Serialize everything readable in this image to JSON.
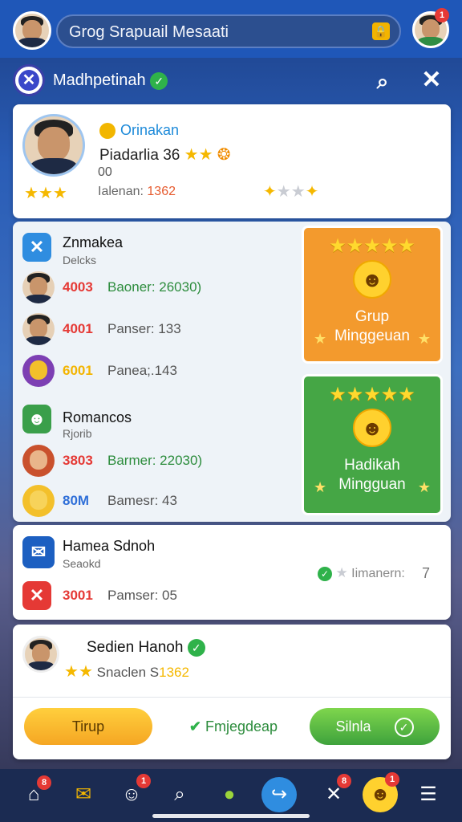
{
  "topbar": {
    "search_text": "Grog Srapuail Mesaati",
    "notification_badge": "1"
  },
  "header": {
    "title": "Madhpetinah"
  },
  "profile": {
    "role": "Orinakan",
    "name": "Piadarlia 36",
    "sub": "00",
    "rank_label": "Ialenan:",
    "rank_value": "1362"
  },
  "groups": [
    {
      "title": "Znmakea",
      "subtitle": "Delcks",
      "rows": [
        {
          "score": "4003",
          "name": "Baoner: 26030)"
        },
        {
          "score": "4001",
          "name": "Panser: 133"
        },
        {
          "score": "6001",
          "name": "Panea;.143"
        }
      ]
    },
    {
      "title": "Romancos",
      "subtitle": "Rjorib",
      "rows": [
        {
          "score": "3803",
          "name": "Barmer: 22030)"
        },
        {
          "score": "80M",
          "name": "Bamesr: 43"
        }
      ]
    }
  ],
  "promos": [
    {
      "line1": "Grup",
      "line2": "Minggeuan"
    },
    {
      "line1": "Hadikah",
      "line2": "Mingguan"
    }
  ],
  "members": {
    "title": "Hamea Sdnoh",
    "subtitle": "Seaokd",
    "row_score": "3001",
    "row_name": "Pamser: 05",
    "side_label": "Iimanern:",
    "side_value": "7"
  },
  "group_card": {
    "title": "Sedien Hanoh",
    "sub_label": "Snaclen S",
    "sub_value": "1362",
    "btn_left": "Tirup",
    "btn_mid": "Fmjegdeap",
    "btn_right": "Silnla"
  },
  "nav_badges": [
    "8",
    "1",
    "8",
    "1"
  ],
  "colors": {
    "primary": "#1f57b8",
    "orange": "#f5a623",
    "green": "#4caf50",
    "red": "#e53935",
    "gold": "#f5b800"
  }
}
